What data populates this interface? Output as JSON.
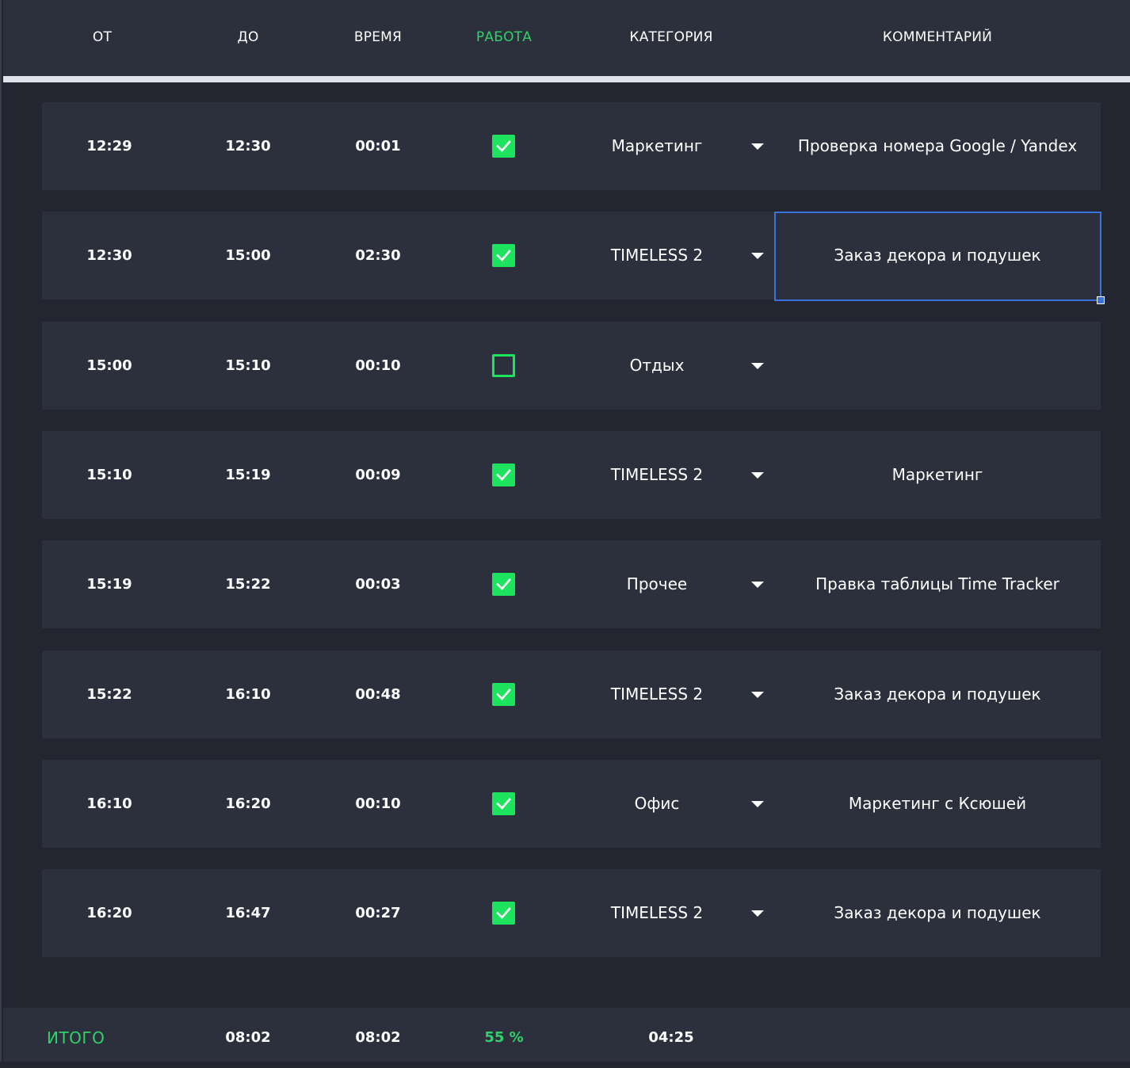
{
  "header": {
    "col_from": "ОТ",
    "col_to": "ДО",
    "col_time": "ВРЕМЯ",
    "col_work": "РАБОТА",
    "col_category": "КАТЕГОРИЯ",
    "col_comment": "КОММЕНТАРИЙ"
  },
  "rows": [
    {
      "from": "12:29",
      "to": "12:30",
      "duration": "00:01",
      "work": true,
      "category": "Маркетинг",
      "comment": "Проверка номера Google / Yandex"
    },
    {
      "from": "12:30",
      "to": "15:00",
      "duration": "02:30",
      "work": true,
      "category": "TIMELESS 2",
      "comment": "Заказ декора и подушек"
    },
    {
      "from": "15:00",
      "to": "15:10",
      "duration": "00:10",
      "work": false,
      "category": "Отдых",
      "comment": ""
    },
    {
      "from": "15:10",
      "to": "15:19",
      "duration": "00:09",
      "work": true,
      "category": "TIMELESS 2",
      "comment": "Маркетинг"
    },
    {
      "from": "15:19",
      "to": "15:22",
      "duration": "00:03",
      "work": true,
      "category": "Прочее",
      "comment": "Правка таблицы Time Tracker"
    },
    {
      "from": "15:22",
      "to": "16:10",
      "duration": "00:48",
      "work": true,
      "category": "TIMELESS 2",
      "comment": "Заказ декора и подушек"
    },
    {
      "from": "16:10",
      "to": "16:20",
      "duration": "00:10",
      "work": true,
      "category": "Офис",
      "comment": "Маркетинг с Ксюшей"
    },
    {
      "from": "16:20",
      "to": "16:47",
      "duration": "00:27",
      "work": true,
      "category": "TIMELESS 2",
      "comment": "Заказ декора и подушек"
    }
  ],
  "footer": {
    "label": "ИТОГО",
    "total_to": "08:02",
    "total_time": "08:02",
    "work_percent": "55 %",
    "category_total": "04:25"
  },
  "colors": {
    "background": "#232631",
    "row": "#2c303d",
    "accent": "#2fd269",
    "checkbox": "#1ee35f",
    "selection": "#3b73dd"
  },
  "icons": {
    "checkbox_checked": "check-icon",
    "dropdown": "caret-down-icon"
  },
  "selected_cell": "row 2, comment"
}
